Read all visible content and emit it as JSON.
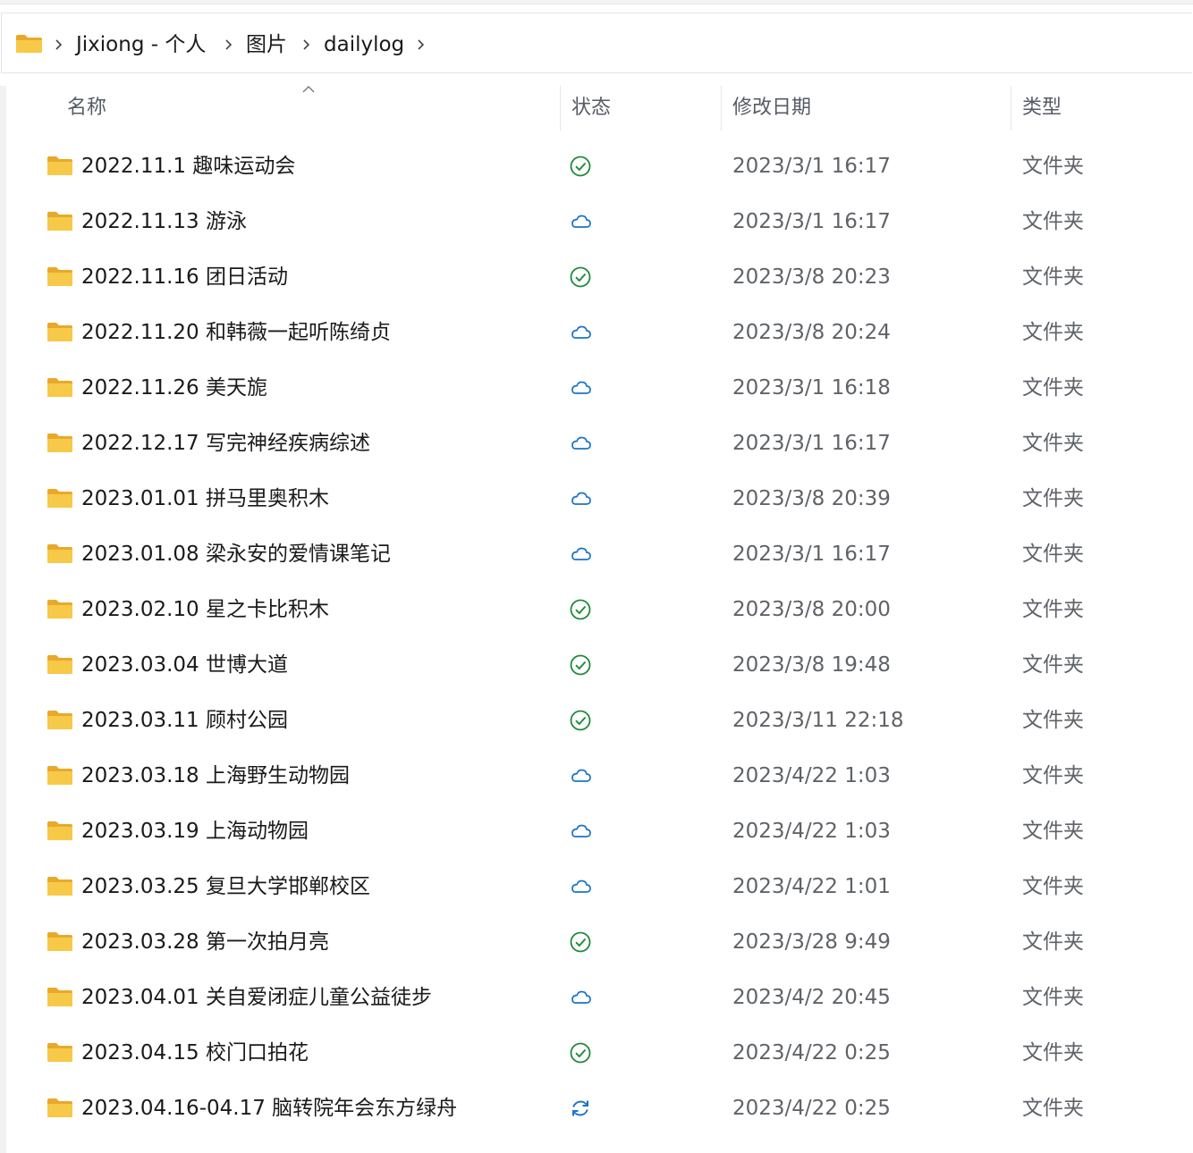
{
  "breadcrumb": {
    "icon": "folder-icon",
    "items": [
      "Jixiong - 个人",
      "图片",
      "dailylog"
    ]
  },
  "columns": {
    "name": "名称",
    "status": "状态",
    "date": "修改日期",
    "type": "类型"
  },
  "sort": {
    "column": "name",
    "direction": "ascending"
  },
  "colors": {
    "folder": "#f2c14e",
    "synced": "#1f8a3a",
    "cloud": "#1a73c8",
    "syncing": "#1a73c8"
  },
  "rows": [
    {
      "name": "2022.11.1 趣味运动会",
      "status": "synced",
      "date": "2023/3/1 16:17",
      "type": "文件夹"
    },
    {
      "name": "2022.11.13 游泳",
      "status": "cloud",
      "date": "2023/3/1 16:17",
      "type": "文件夹"
    },
    {
      "name": "2022.11.16 团日活动",
      "status": "synced",
      "date": "2023/3/8 20:23",
      "type": "文件夹"
    },
    {
      "name": "2022.11.20 和韩薇一起听陈绮贞",
      "status": "cloud",
      "date": "2023/3/8 20:24",
      "type": "文件夹"
    },
    {
      "name": "2022.11.26 美天旎",
      "status": "cloud",
      "date": "2023/3/1 16:18",
      "type": "文件夹"
    },
    {
      "name": "2022.12.17 写完神经疾病综述",
      "status": "cloud",
      "date": "2023/3/1 16:17",
      "type": "文件夹"
    },
    {
      "name": "2023.01.01 拼马里奥积木",
      "status": "cloud",
      "date": "2023/3/8 20:39",
      "type": "文件夹"
    },
    {
      "name": "2023.01.08 梁永安的爱情课笔记",
      "status": "cloud",
      "date": "2023/3/1 16:17",
      "type": "文件夹"
    },
    {
      "name": "2023.02.10 星之卡比积木",
      "status": "synced",
      "date": "2023/3/8 20:00",
      "type": "文件夹"
    },
    {
      "name": "2023.03.04 世博大道",
      "status": "synced",
      "date": "2023/3/8 19:48",
      "type": "文件夹"
    },
    {
      "name": "2023.03.11 顾村公园",
      "status": "synced",
      "date": "2023/3/11 22:18",
      "type": "文件夹"
    },
    {
      "name": "2023.03.18 上海野生动物园",
      "status": "cloud",
      "date": "2023/4/22 1:03",
      "type": "文件夹"
    },
    {
      "name": "2023.03.19 上海动物园",
      "status": "cloud",
      "date": "2023/4/22 1:03",
      "type": "文件夹"
    },
    {
      "name": "2023.03.25 复旦大学邯郸校区",
      "status": "cloud",
      "date": "2023/4/22 1:01",
      "type": "文件夹"
    },
    {
      "name": "2023.03.28 第一次拍月亮",
      "status": "synced",
      "date": "2023/3/28 9:49",
      "type": "文件夹"
    },
    {
      "name": "2023.04.01 关自爱闭症儿童公益徒步",
      "status": "cloud",
      "date": "2023/4/2 20:45",
      "type": "文件夹"
    },
    {
      "name": "2023.04.15 校门口拍花",
      "status": "synced",
      "date": "2023/4/22 0:25",
      "type": "文件夹"
    },
    {
      "name": "2023.04.16-04.17 脑转院年会东方绿舟",
      "status": "syncing",
      "date": "2023/4/22 0:25",
      "type": "文件夹"
    }
  ]
}
